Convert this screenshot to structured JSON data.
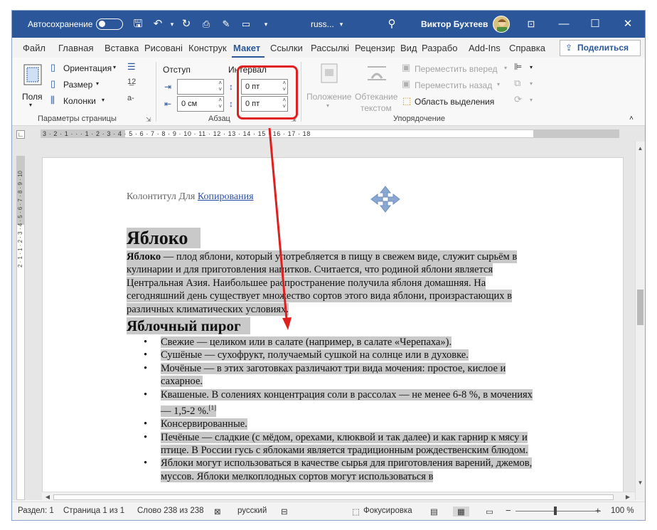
{
  "titlebar": {
    "autosave_label": "Автосохранение",
    "doc_name": "russ...",
    "user_name": "Виктор Бухтеев"
  },
  "tabs": [
    "Файл",
    "Главная",
    "Вставка",
    "Рисовані",
    "Конструк",
    "Макет",
    "Ссылки",
    "Рассылкі",
    "Рецензир",
    "Вид",
    "Разрабо",
    "Add-Ins",
    "Справка"
  ],
  "active_tab": "Макет",
  "share_label": "Поделиться",
  "ribbon": {
    "page_setup": {
      "fields_label": "Поля",
      "orientation_label": "Ориентация",
      "size_label": "Размер",
      "columns_label": "Колонки",
      "group_name": "Параметры страницы"
    },
    "paragraph": {
      "indent_label": "Отступ",
      "spacing_label": "Интервал",
      "indent_left_value": "",
      "indent_right_value": "0 см",
      "spacing_before_value": "0 пт",
      "spacing_after_value": "0 пт",
      "group_name": "Абзац"
    },
    "arrange": {
      "position_label": "Положение",
      "wrap_label_1": "Обтекание",
      "wrap_label_2": "текстом",
      "bring_forward": "Переместить вперед",
      "send_backward": "Переместить назад",
      "selection_pane": "Область выделения",
      "group_name": "Упорядочение"
    }
  },
  "ruler_text": "3 · 2 · 1 · · · 1 · 2 · 3 · 4 · 5 · 6 · 7 · 8 · 9 · 10 · 11 · 12 · 13 · 14 · 15 · 16 · 17 · 18",
  "vruler_text": "2 · 1 · 1 · 2 · 3 · 4 · 5 · 6 · 7 · 8 · 9 · 10",
  "document": {
    "header_plain": "Колонтитул Для ",
    "header_link": "Копирования",
    "heading1": "Яблоко",
    "para_bold": "Яблоко",
    "para_rest": " — плод яблони, который употребляется в пищу в свежем виде, служит сырьём в кулинарии и для приготовления напитков. Считается, что родиной яблони является Центральная Азия. Наибольшее распространение получила яблоня домашняя. На сегодняшний день существует множество сортов этого вида яблони, произрастающих в различных климатических условиях.",
    "heading2": "Яблочный пирог",
    "bullet_char": "•",
    "list_items": [
      "Свежие — целиком или в салате (например, в салате «Черепаха»).",
      "Сушёные — сухофрукт, получаемый сушкой на солнце или в духовке.",
      "Мочёные — в этих заготовках различают три вида мочения: простое, кислое и сахарное.",
      "Квашеные. В солениях концентрация соли в рассолах — не менее 6-8 %, в мочениях — 1,5-2 %.",
      "Консервированные.",
      "Печёные — сладкие (с мёдом, орехами, клюквой и так далее) и как гарнир к мясу и птице. В России гусь с яблоками является традиционным рождественским блюдом.",
      "Яблоки могут использоваться в качестве сырья для приготовления варений, джемов, муссов. Яблоки мелкоплодных сортов могут использоваться в"
    ],
    "footnote_mark": "[1]"
  },
  "statusbar": {
    "section": "Раздел: 1",
    "page": "Страница 1 из 1",
    "words": "Слово 238 из 238",
    "language": "русский",
    "focus": "Фокусировка",
    "zoom": "100 %",
    "zoom_minus": "−",
    "zoom_plus": "+"
  },
  "colors": {
    "titlebar": "#2b579a",
    "annotation": "#e01f1f",
    "selection": "#c9c9c9"
  }
}
